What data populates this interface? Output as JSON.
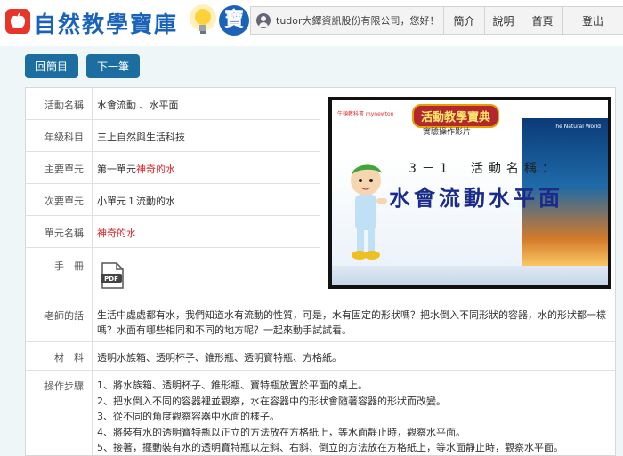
{
  "header": {
    "logo_text": "自然教學寶庫",
    "logo_tail": "寶",
    "greeting": "tudor大鐸資訊股份有限公司，您好！",
    "nav": [
      "簡介",
      "說明",
      "首頁",
      "登出"
    ]
  },
  "actions": {
    "back_label": "回簡目",
    "next_label": "下一筆"
  },
  "details": {
    "rows": [
      {
        "label": "活動名稱",
        "value": "水會流動 、水平面"
      },
      {
        "label": "年級科目",
        "value": "三上自然與生活科技"
      },
      {
        "label": "主要單元",
        "value_prefix": "第一單元",
        "value_highlight": "神奇的水"
      },
      {
        "label": "次要單元",
        "value": "小單元１流動的水"
      },
      {
        "label": "單元名稱",
        "value_highlight": "神奇的水"
      },
      {
        "label": "手　冊",
        "icon": "pdf-file-icon",
        "icon_text": "PDF"
      }
    ],
    "teacher_label": "老師的話",
    "teacher_text": "生活中處處都有水，我們知道水有流動的性質，可是，水有固定的形狀嗎？把水倒入不同形狀的容器，水的形狀都一樣嗎？水面有哪些相同和不同的地方呢？一起來動手試試看。",
    "materials_label": "材　料",
    "materials_text": "透明水族箱、透明杯子、錐形瓶、透明寶特瓶、方格紙。",
    "steps_label": "操作步驟",
    "steps": [
      "1、將水族箱、透明杯子、錐形瓶、寶特瓶放置於平面的桌上。",
      "2、把水倒入不同的容器裡並觀察，水在容器中的形狀會隨著容器的形狀而改變。",
      "3、從不同的角度觀察容器中水面的樣子。",
      "4、將裝有水的透明寶特瓶以正立的方法放在方格紙上，等水面靜止時，觀察水平面。",
      "5、接著，擺動裝有水的透明寶特瓶以左斜、右斜、倒立的方法放在方格紙上，等水面靜止時，觀察水平面。"
    ]
  },
  "video": {
    "title": "活動教學寶典",
    "subtitle": "實驗操作影片",
    "number": "3－1　活動名稱：",
    "big_title": "水會流動水平面",
    "brand": "牛頓教科書 mynewton",
    "right_text": "The Natural World"
  },
  "colors": {
    "brand_blue": "#1a63b8",
    "button_blue": "#1d6ea0",
    "highlight_red": "#d9272e"
  }
}
